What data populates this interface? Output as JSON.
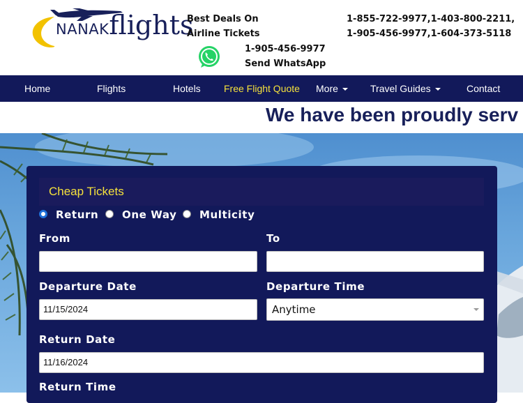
{
  "header": {
    "logo": {
      "brand_prefix": "NANAK",
      "brand_main": "flights"
    },
    "deals_line1": "Best Deals On",
    "deals_line2": "Airline Tickets",
    "phones_line1": "1-855-722-9977,1-403-800-2211,",
    "phones_line2": "1-905-456-9977,1-604-373-5118",
    "whatsapp_number": "1-905-456-9977",
    "whatsapp_label": "Send WhatsApp"
  },
  "nav": {
    "items": [
      {
        "label": "Home"
      },
      {
        "label": "Flights"
      },
      {
        "label": "Hotels"
      },
      {
        "label": "Free Flight Quote",
        "active": true
      },
      {
        "label": "More",
        "dropdown": true
      },
      {
        "label": "Travel Guides",
        "dropdown": true
      },
      {
        "label": "Contact"
      }
    ]
  },
  "banner": {
    "text": "We have been proudly serv"
  },
  "form": {
    "title": "Cheap Tickets",
    "trip_types": [
      {
        "label": "Return",
        "selected": true
      },
      {
        "label": "One Way",
        "selected": false
      },
      {
        "label": "Multicity",
        "selected": false
      }
    ],
    "from_label": "From",
    "from_value": "",
    "to_label": "To",
    "to_value": "",
    "departure_date_label": "Departure Date",
    "departure_date_value": "11/15/2024",
    "departure_time_label": "Departure Time",
    "departure_time_value": "Anytime",
    "return_date_label": "Return Date",
    "return_date_value": "11/16/2024",
    "return_time_label": "Return Time"
  },
  "colors": {
    "navy": "#12195a",
    "accent_yellow": "#f5e13c",
    "radio_selected": "#1e6fd9",
    "whatsapp_green": "#25d366"
  },
  "icons": {
    "logo": "airplane-swoosh-logo",
    "whatsapp": "whatsapp-icon",
    "dropdown": "caret-down-icon"
  }
}
